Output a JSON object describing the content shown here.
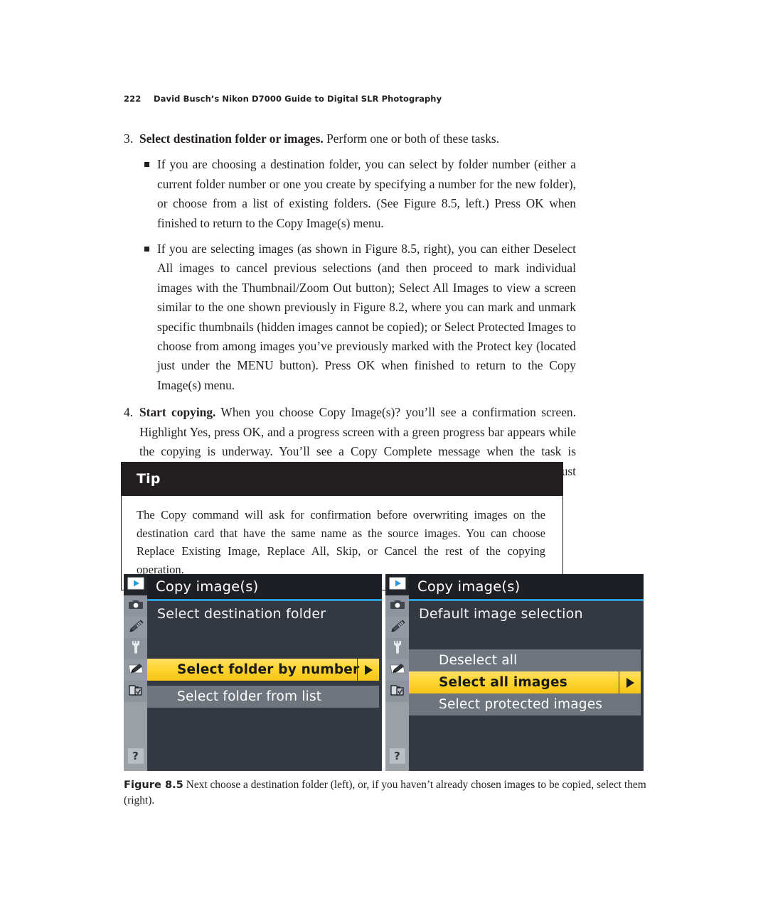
{
  "running_head": {
    "page_number": "222",
    "book_title": "David Busch’s Nikon D7000 Guide to Digital SLR Photography"
  },
  "steps": [
    {
      "number": "3.",
      "lead": "Select destination folder or images.",
      "text": " Perform one or both of these tasks.",
      "bullets": [
        "If you are choosing a destination folder, you can select by folder number (either a current folder number or one you create by specifying a number for the new folder), or choose from a list of existing folders. (See Figure 8.5, left.) Press OK when finished to return to the Copy Image(s) menu.",
        "If you are selecting images (as shown in Figure 8.5, right), you can either Deselect All images to cancel previous selections (and then proceed to mark individual images with the Thumbnail/Zoom Out button); Select All Images to view a screen similar to the one shown previously in Figure 8.2, where you can mark and unmark specific thumbnails (hidden images cannot be copied); or Select Protected Images to choose from among images you’ve previously marked with the Protect key (located just under the MENU button). Press OK when finished to return to the Copy Image(s) menu."
      ]
    },
    {
      "number": "4.",
      "lead": "Start copying.",
      "text": " When you choose Copy Image(s)? you’ll see a confirmation screen. Highlight Yes, press OK, and a progress screen with a green progress bar appears while the copying is underway. You’ll see a Copy Complete message when the task is finished. Press OK, and then the MENU button twice to back out of the menus; or just tap the shutter release button.",
      "bullets": []
    }
  ],
  "tip": {
    "heading": "Tip",
    "body": "The Copy command will ask for confirmation before overwriting images on the destination card that have the same name as the source images. You can choose Replace Existing Image, Replace All, Skip, or Cancel the rest of the copying operation."
  },
  "figure": {
    "screens": [
      {
        "title": "Copy image(s)",
        "subtitle": "Select destination folder",
        "help_label": "?",
        "rows": [
          {
            "label": "Select folder by number",
            "state": "highlight",
            "has_arrow": true
          },
          {
            "label": "",
            "state": "spacer",
            "has_arrow": false
          },
          {
            "label": "Select folder from list",
            "state": "gray",
            "has_arrow": false
          }
        ]
      },
      {
        "title": "Copy image(s)",
        "subtitle": "Default image selection",
        "help_label": "?",
        "rows": [
          {
            "label": "Deselect all",
            "state": "gray",
            "has_arrow": false
          },
          {
            "label": "Select all images",
            "state": "highlight",
            "has_arrow": true
          },
          {
            "label": "Select protected images",
            "state": "gray",
            "has_arrow": false
          }
        ]
      }
    ],
    "sidebar_icons": [
      "playback-icon",
      "shooting-menu-camera-icon",
      "custom-settings-pencil-icon",
      "setup-menu-wrench-icon",
      "retouch-menu-brush-icon",
      "recent-settings-icon"
    ],
    "caption_lead": "Figure 8.5",
    "caption_text": "Next choose a destination folder (left), or, if you haven’t already chosen images to be copied, select them (right)."
  },
  "colors": {
    "lcd_background": "#343840",
    "lcd_titlebar": "#1d1f24",
    "accent_rule": "#2e9bd6",
    "highlight_yellow": "#ffd633",
    "row_gray": "#6e757d",
    "sidebar_gray": "#9aa0a6",
    "tip_header": "#231f20",
    "text": "#231f20"
  }
}
